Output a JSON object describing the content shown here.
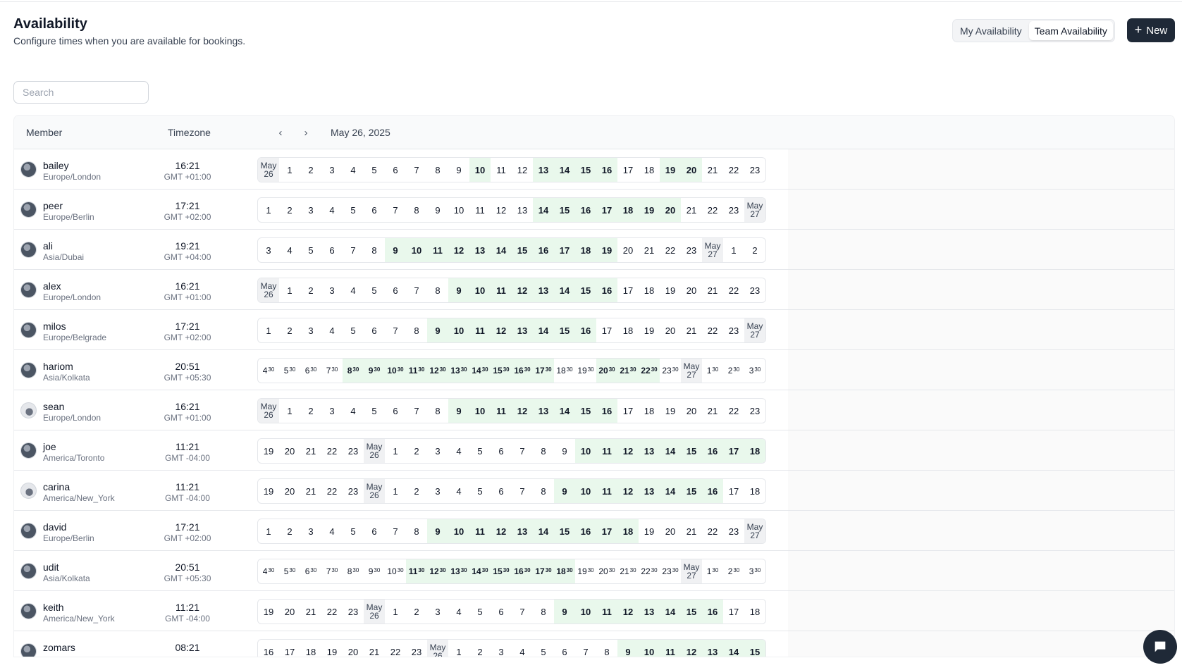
{
  "header": {
    "title": "Availability",
    "subtitle": "Configure times when you are available for bookings."
  },
  "toggle": {
    "my": "My Availability",
    "team": "Team Availability",
    "active": "team"
  },
  "new_button": {
    "icon": "plus-icon",
    "label": "New"
  },
  "search": {
    "placeholder": "Search",
    "value": ""
  },
  "table": {
    "columns": {
      "member": "Member",
      "timezone": "Timezone"
    },
    "nav": {
      "prev_icon": "chevron-left-icon",
      "next_icon": "chevron-right-icon"
    },
    "date": "May 26, 2025",
    "colors": {
      "available": "#e9f8ec",
      "day_marker": "#f0f1f3"
    }
  },
  "members": [
    {
      "name": "bailey",
      "tz": "Europe/London",
      "time": "16:21",
      "offset": "GMT +01:00",
      "start": 0,
      "half": false,
      "next_day": "May 26",
      "hours": [
        "May 26",
        "1",
        "2",
        "3",
        "4",
        "5",
        "6",
        "7",
        "8",
        "9",
        "10",
        "11",
        "12",
        "13",
        "14",
        "15",
        "16",
        "17",
        "18",
        "19",
        "20",
        "21",
        "22",
        "23"
      ],
      "available": [
        "10",
        "13",
        "14",
        "15",
        "16",
        "19",
        "20"
      ]
    },
    {
      "name": "peer",
      "tz": "Europe/Berlin",
      "time": "17:21",
      "offset": "GMT +02:00",
      "half": false,
      "hours": [
        "1",
        "2",
        "3",
        "4",
        "5",
        "6",
        "7",
        "8",
        "9",
        "10",
        "11",
        "12",
        "13",
        "14",
        "15",
        "16",
        "17",
        "18",
        "19",
        "20",
        "21",
        "22",
        "23",
        "May 27"
      ],
      "available": [
        "14",
        "15",
        "16",
        "17",
        "18",
        "19",
        "20"
      ]
    },
    {
      "name": "ali",
      "tz": "Asia/Dubai",
      "time": "19:21",
      "offset": "GMT +04:00",
      "half": false,
      "hours": [
        "3",
        "4",
        "5",
        "6",
        "7",
        "8",
        "9",
        "10",
        "11",
        "12",
        "13",
        "14",
        "15",
        "16",
        "17",
        "18",
        "19",
        "20",
        "21",
        "22",
        "23",
        "May 27",
        "1",
        "2"
      ],
      "available": [
        "9",
        "10",
        "11",
        "12",
        "13",
        "14",
        "15",
        "16",
        "17",
        "18",
        "19"
      ]
    },
    {
      "name": "alex",
      "tz": "Europe/London",
      "time": "16:21",
      "offset": "GMT +01:00",
      "half": false,
      "hours": [
        "May 26",
        "1",
        "2",
        "3",
        "4",
        "5",
        "6",
        "7",
        "8",
        "9",
        "10",
        "11",
        "12",
        "13",
        "14",
        "15",
        "16",
        "17",
        "18",
        "19",
        "20",
        "21",
        "22",
        "23"
      ],
      "available": [
        "9",
        "10",
        "11",
        "12",
        "13",
        "14",
        "15",
        "16"
      ]
    },
    {
      "name": "milos",
      "tz": "Europe/Belgrade",
      "time": "17:21",
      "offset": "GMT +02:00",
      "half": false,
      "hours": [
        "1",
        "2",
        "3",
        "4",
        "5",
        "6",
        "7",
        "8",
        "9",
        "10",
        "11",
        "12",
        "13",
        "14",
        "15",
        "16",
        "17",
        "18",
        "19",
        "20",
        "21",
        "22",
        "23",
        "May 27"
      ],
      "available": [
        "9",
        "10",
        "11",
        "12",
        "13",
        "14",
        "15",
        "16"
      ]
    },
    {
      "name": "hariom",
      "tz": "Asia/Kolkata",
      "time": "20:51",
      "offset": "GMT +05:30",
      "half": true,
      "hours": [
        "4",
        "5",
        "6",
        "7",
        "8",
        "9",
        "10",
        "11",
        "12",
        "13",
        "14",
        "15",
        "16",
        "17",
        "18",
        "19",
        "20",
        "21",
        "22",
        "23",
        "May 27",
        "1",
        "2",
        "3"
      ],
      "available": [
        "8",
        "9",
        "10",
        "11",
        "12",
        "13",
        "14",
        "15",
        "16",
        "17",
        "20",
        "21",
        "22"
      ]
    },
    {
      "name": "sean",
      "tz": "Europe/London",
      "time": "16:21",
      "offset": "GMT +01:00",
      "half": false,
      "hours": [
        "May 26",
        "1",
        "2",
        "3",
        "4",
        "5",
        "6",
        "7",
        "8",
        "9",
        "10",
        "11",
        "12",
        "13",
        "14",
        "15",
        "16",
        "17",
        "18",
        "19",
        "20",
        "21",
        "22",
        "23"
      ],
      "available": [
        "9",
        "10",
        "11",
        "12",
        "13",
        "14",
        "15",
        "16"
      ]
    },
    {
      "name": "joe",
      "tz": "America/Toronto",
      "time": "11:21",
      "offset": "GMT -04:00",
      "half": false,
      "hours": [
        "19",
        "20",
        "21",
        "22",
        "23",
        "May 26",
        "1",
        "2",
        "3",
        "4",
        "5",
        "6",
        "7",
        "8",
        "9",
        "10",
        "11",
        "12",
        "13",
        "14",
        "15",
        "16",
        "17",
        "18"
      ],
      "available": [
        "10",
        "11",
        "12",
        "13",
        "14",
        "15",
        "16",
        "17",
        "18"
      ]
    },
    {
      "name": "carina",
      "tz": "America/New_York",
      "time": "11:21",
      "offset": "GMT -04:00",
      "half": false,
      "hours": [
        "19",
        "20",
        "21",
        "22",
        "23",
        "May 26",
        "1",
        "2",
        "3",
        "4",
        "5",
        "6",
        "7",
        "8",
        "9",
        "10",
        "11",
        "12",
        "13",
        "14",
        "15",
        "16",
        "17",
        "18"
      ],
      "available": [
        "9",
        "10",
        "11",
        "12",
        "13",
        "14",
        "15",
        "16"
      ]
    },
    {
      "name": "david",
      "tz": "Europe/Berlin",
      "time": "17:21",
      "offset": "GMT +02:00",
      "half": false,
      "hours": [
        "1",
        "2",
        "3",
        "4",
        "5",
        "6",
        "7",
        "8",
        "9",
        "10",
        "11",
        "12",
        "13",
        "14",
        "15",
        "16",
        "17",
        "18",
        "19",
        "20",
        "21",
        "22",
        "23",
        "May 27"
      ],
      "available": [
        "9",
        "10",
        "11",
        "12",
        "13",
        "14",
        "15",
        "16",
        "17",
        "18"
      ]
    },
    {
      "name": "udit",
      "tz": "Asia/Kolkata",
      "time": "20:51",
      "offset": "GMT +05:30",
      "half": true,
      "hours": [
        "4",
        "5",
        "6",
        "7",
        "8",
        "9",
        "10",
        "11",
        "12",
        "13",
        "14",
        "15",
        "16",
        "17",
        "18",
        "19",
        "20",
        "21",
        "22",
        "23",
        "May 27",
        "1",
        "2",
        "3"
      ],
      "available": [
        "11",
        "12",
        "13",
        "14",
        "15",
        "16",
        "17",
        "18"
      ]
    },
    {
      "name": "keith",
      "tz": "America/New_York",
      "time": "11:21",
      "offset": "GMT -04:00",
      "half": false,
      "hours": [
        "19",
        "20",
        "21",
        "22",
        "23",
        "May 26",
        "1",
        "2",
        "3",
        "4",
        "5",
        "6",
        "7",
        "8",
        "9",
        "10",
        "11",
        "12",
        "13",
        "14",
        "15",
        "16",
        "17",
        "18"
      ],
      "available": [
        "9",
        "10",
        "11",
        "12",
        "13",
        "14",
        "15",
        "16"
      ]
    },
    {
      "name": "zomars",
      "tz": "",
      "time": "08:21",
      "offset": "",
      "half": false,
      "hours": [
        "16",
        "17",
        "18",
        "19",
        "20",
        "21",
        "22",
        "23",
        "May 26",
        "1",
        "2",
        "3",
        "4",
        "5",
        "6",
        "7",
        "8",
        "9",
        "10",
        "11",
        "12",
        "13",
        "14",
        "15"
      ],
      "available": [
        "9",
        "10",
        "11",
        "12",
        "13",
        "14",
        "15"
      ]
    }
  ],
  "chat": {
    "icon": "chat-bubble-icon"
  }
}
